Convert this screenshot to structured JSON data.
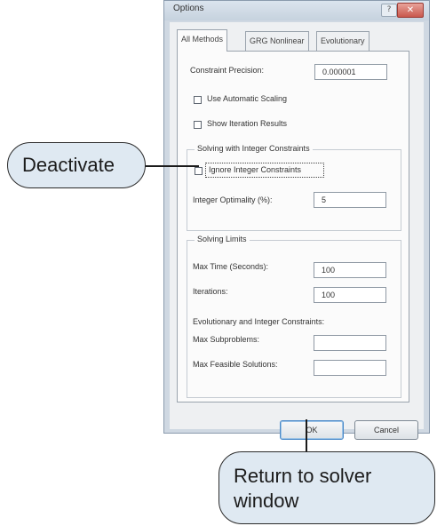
{
  "window": {
    "title": "Options",
    "help_glyph": "?",
    "close_glyph": "✕"
  },
  "tabs": [
    "All Methods",
    "GRG Nonlinear",
    "Evolutionary"
  ],
  "constraint_precision": {
    "label": "Constraint Precision:",
    "value": "0.000001"
  },
  "use_automatic_scaling": {
    "label": "Use Automatic Scaling",
    "checked": false
  },
  "show_iteration_results": {
    "label": "Show Iteration Results",
    "checked": false
  },
  "integer_group": {
    "title": "Solving with Integer Constraints",
    "ignore_label": "Ignore Integer Constraints",
    "ignore_checked": false,
    "optimality_label": "Integer Optimality (%):",
    "optimality_value": "5"
  },
  "limits_group": {
    "title": "Solving Limits",
    "max_time_label": "Max Time (Seconds):",
    "max_time_value": "100",
    "iterations_label": "Iterations:",
    "iterations_value": "100",
    "evo_heading": "Evolutionary and Integer Constraints:",
    "max_subproblems_label": "Max Subproblems:",
    "max_subproblems_value": "",
    "max_feasible_label": "Max Feasible Solutions:",
    "max_feasible_value": ""
  },
  "buttons": {
    "ok": "OK",
    "cancel": "Cancel"
  },
  "callouts": {
    "deactivate": "Deactivate",
    "return": "Return to solver window"
  },
  "colors": {
    "callout_fill": "#dfe9f2",
    "dialog_frame": "#cfd8e2"
  }
}
